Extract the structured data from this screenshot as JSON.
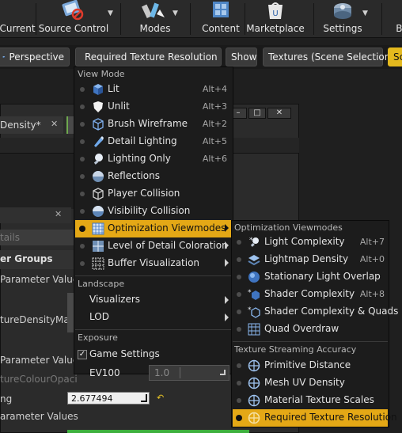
{
  "toolbar": {
    "current": "Current",
    "source_control": "Source Control",
    "modes": "Modes",
    "content": "Content",
    "marketplace": "Marketplace",
    "settings": "Settings",
    "cut_off": "Bl"
  },
  "viewport_bar": {
    "perspective": "Perspective",
    "view_mode": "Required Texture Resolution",
    "show": "Show",
    "textures": "Textures (Scene Selection)",
    "cut_off": "Sc"
  },
  "background": {
    "tab_title": "Density*",
    "search_placeholder": "tails",
    "param_groups": "er Groups",
    "rows": [
      "Parameter Value",
      "tureDensityMap",
      "Parameter Values",
      "tureColourOpaci",
      "ng",
      "arameter Values"
    ],
    "value_field": "2.677494"
  },
  "menu": {
    "view_mode_header": "View Mode",
    "items": [
      {
        "label": "Lit",
        "shortcut": "Alt+4"
      },
      {
        "label": "Unlit",
        "shortcut": "Alt+3"
      },
      {
        "label": "Brush Wireframe",
        "shortcut": "Alt+2"
      },
      {
        "label": "Detail Lighting",
        "shortcut": "Alt+5"
      },
      {
        "label": "Lighting Only",
        "shortcut": "Alt+6"
      },
      {
        "label": "Reflections",
        "shortcut": ""
      },
      {
        "label": "Player Collision",
        "shortcut": ""
      },
      {
        "label": "Visibility Collision",
        "shortcut": ""
      },
      {
        "label": "Optimization Viewmodes",
        "shortcut": ""
      },
      {
        "label": "Level of Detail Coloration",
        "shortcut": ""
      },
      {
        "label": "Buffer Visualization",
        "shortcut": ""
      }
    ],
    "landscape_header": "Landscape",
    "visualizers": "Visualizers",
    "lod": "LOD",
    "exposure_header": "Exposure",
    "game_settings": "Game Settings",
    "game_settings_checked": true,
    "ev100": "EV100",
    "ev100_value": "1.0"
  },
  "submenu": {
    "optimization_header": "Optimization Viewmodes",
    "optimization_items": [
      {
        "label": "Light Complexity",
        "shortcut": "Alt+7"
      },
      {
        "label": "Lightmap Density",
        "shortcut": "Alt+0"
      },
      {
        "label": "Stationary Light Overlap",
        "shortcut": ""
      },
      {
        "label": "Shader Complexity",
        "shortcut": "Alt+8"
      },
      {
        "label": "Shader Complexity & Quads",
        "shortcut": ""
      },
      {
        "label": "Quad Overdraw",
        "shortcut": ""
      }
    ],
    "texture_header": "Texture Streaming Accuracy",
    "texture_items": [
      {
        "label": "Primitive Distance"
      },
      {
        "label": "Mesh UV Density"
      },
      {
        "label": "Material Texture Scales"
      },
      {
        "label": "Required Texture Resolution"
      }
    ]
  },
  "colors": {
    "accent": "#e4a816",
    "menu_bg": "#1c1c1c",
    "toolbar_bg": "#2a2a2a"
  }
}
